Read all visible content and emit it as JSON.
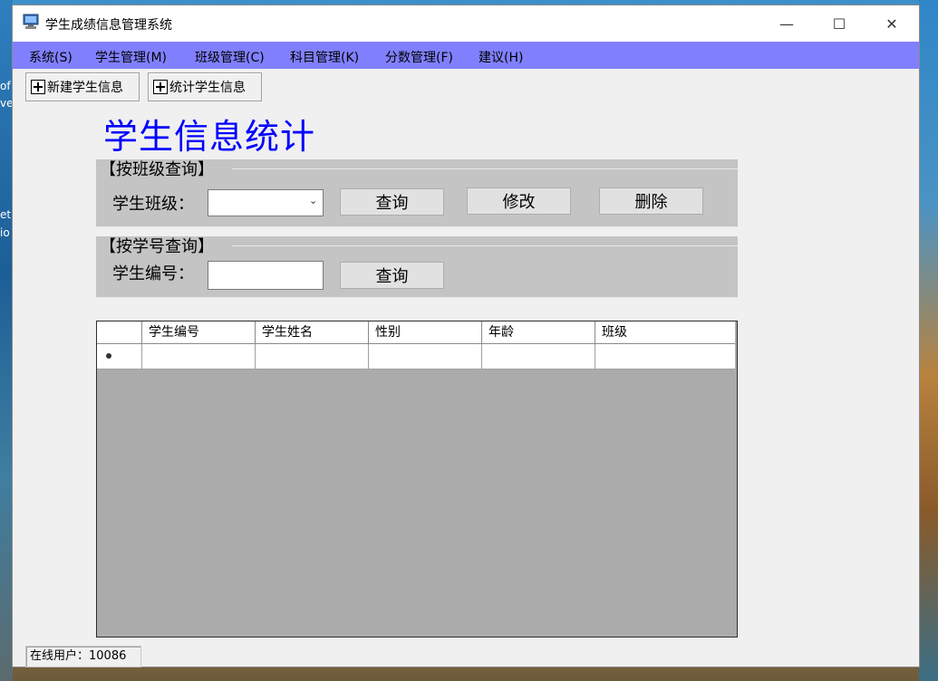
{
  "window": {
    "title": "学生成绩信息管理系统",
    "controls": {
      "minimize": "—",
      "maximize": "☐",
      "close": "✕"
    }
  },
  "menu": [
    {
      "label": "系统(S)"
    },
    {
      "label": "学生管理(M)"
    },
    {
      "label": "班级管理(C)"
    },
    {
      "label": "科目管理(K)"
    },
    {
      "label": "分数管理(F)"
    },
    {
      "label": "建议(H)"
    }
  ],
  "toolbar": {
    "new_student": "新建学生信息",
    "stats_student": "统计学生信息"
  },
  "page": {
    "heading": "学生信息统计"
  },
  "class_query": {
    "group_title": "【按班级查询】",
    "label": "学生班级：",
    "selected": "",
    "query_button": "查询",
    "edit_button": "修改",
    "delete_button": "删除"
  },
  "id_query": {
    "group_title": "【按学号查询】",
    "label": "学生编号：",
    "value": "",
    "query_button": "查询"
  },
  "grid": {
    "columns": [
      "学生编号",
      "学生姓名",
      "性别",
      "年龄",
      "班级"
    ],
    "new_row_marker": "*"
  },
  "status": {
    "online_user": "在线用户：10086"
  },
  "desktop": {
    "icon_text_1": "of",
    "icon_text_2": "ve",
    "icon_text_3": "et",
    "icon_text_4": "io"
  },
  "colors": {
    "menubar": "#8080ff",
    "heading": "#0000ff",
    "grid_background": "#ababab"
  }
}
